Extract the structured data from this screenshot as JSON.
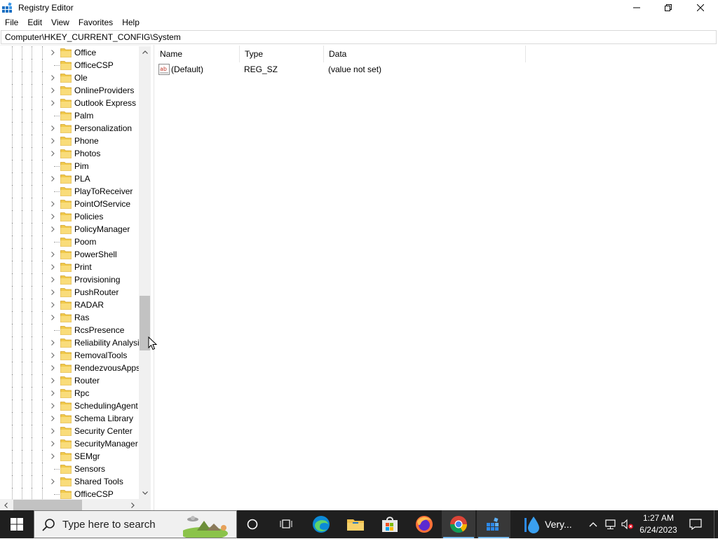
{
  "window": {
    "title": "Registry Editor"
  },
  "menu": [
    "File",
    "Edit",
    "View",
    "Favorites",
    "Help"
  ],
  "address": "Computer\\HKEY_CURRENT_CONFIG\\System",
  "tree": {
    "items": [
      {
        "label": "Office",
        "expandable": true
      },
      {
        "label": "OfficeCSP",
        "expandable": false
      },
      {
        "label": "Ole",
        "expandable": true
      },
      {
        "label": "OnlineProviders",
        "expandable": true
      },
      {
        "label": "Outlook Express",
        "expandable": true
      },
      {
        "label": "Palm",
        "expandable": false
      },
      {
        "label": "Personalization",
        "expandable": true
      },
      {
        "label": "Phone",
        "expandable": true
      },
      {
        "label": "Photos",
        "expandable": true
      },
      {
        "label": "Pim",
        "expandable": false
      },
      {
        "label": "PLA",
        "expandable": true
      },
      {
        "label": "PlayToReceiver",
        "expandable": false
      },
      {
        "label": "PointOfService",
        "expandable": true
      },
      {
        "label": "Policies",
        "expandable": true
      },
      {
        "label": "PolicyManager",
        "expandable": true
      },
      {
        "label": "Poom",
        "expandable": false
      },
      {
        "label": "PowerShell",
        "expandable": true
      },
      {
        "label": "Print",
        "expandable": true
      },
      {
        "label": "Provisioning",
        "expandable": true
      },
      {
        "label": "PushRouter",
        "expandable": true
      },
      {
        "label": "RADAR",
        "expandable": true
      },
      {
        "label": "Ras",
        "expandable": true
      },
      {
        "label": "RcsPresence",
        "expandable": false
      },
      {
        "label": "Reliability Analysis",
        "expandable": true
      },
      {
        "label": "RemovalTools",
        "expandable": true
      },
      {
        "label": "RendezvousApps",
        "expandable": true
      },
      {
        "label": "Router",
        "expandable": true
      },
      {
        "label": "Rpc",
        "expandable": true
      },
      {
        "label": "SchedulingAgent",
        "expandable": true
      },
      {
        "label": "Schema Library",
        "expandable": true
      },
      {
        "label": "Security Center",
        "expandable": true
      },
      {
        "label": "SecurityManager",
        "expandable": true
      },
      {
        "label": "SEMgr",
        "expandable": true
      },
      {
        "label": "Sensors",
        "expandable": false
      },
      {
        "label": "Shared Tools",
        "expandable": true
      },
      {
        "label": "OfficeCSP",
        "expandable": false
      }
    ]
  },
  "list": {
    "columns": {
      "name": "Name",
      "type": "Type",
      "data": "Data"
    },
    "rows": [
      {
        "name": "(Default)",
        "type": "REG_SZ",
        "data": "(value not set)",
        "icon": "string-value-icon"
      }
    ]
  },
  "taskbar": {
    "search_placeholder": "Type here to search",
    "weather": "Very...",
    "time": "1:27 AM",
    "date": "6/24/2023",
    "apps": [
      "cortana-icon",
      "task-view-icon",
      "edge-icon",
      "file-explorer-icon",
      "store-icon",
      "firefox-icon",
      "chrome-icon",
      "regedit-icon"
    ]
  },
  "colors": {
    "folder": "#f0c94a",
    "taskbar": "#1f1f1f",
    "accent": "#76b9ed"
  }
}
